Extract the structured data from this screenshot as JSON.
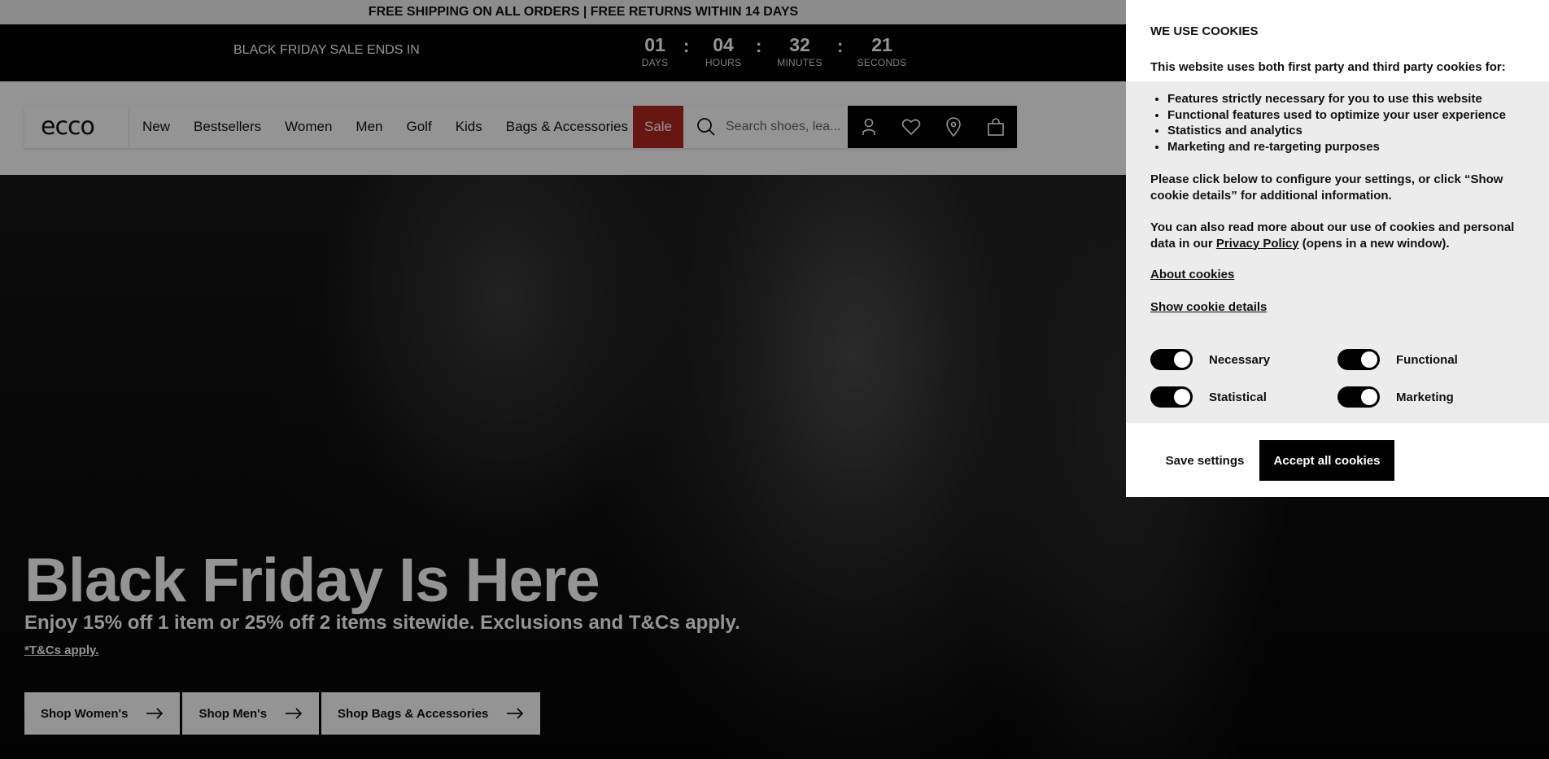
{
  "announcement": "FREE SHIPPING ON ALL ORDERS | FREE RETURNS WITHIN 14 DAYS",
  "countdown": {
    "label": "BLACK FRIDAY SALE ENDS IN",
    "days": "01",
    "days_label": "DAYS",
    "hours": "04",
    "hours_label": "HOURS",
    "minutes": "32",
    "minutes_label": "MINUTES",
    "seconds": "21",
    "seconds_label": "SECONDS",
    "separator": ":"
  },
  "nav": {
    "logo": "ecco",
    "links": [
      "New",
      "Bestsellers",
      "Women",
      "Men",
      "Golf",
      "Kids",
      "Bags & Accessories"
    ],
    "sale": "Sale",
    "search_placeholder": "Search shoes, lea..."
  },
  "hero": {
    "title": "Black Friday Is Here",
    "subtitle": "Enjoy 15% off 1 item or 25% off 2 items sitewide. Exclusions and T&Cs apply.",
    "tc_link": "*T&Cs apply.",
    "buttons": [
      "Shop Women's",
      "Shop Men's",
      "Shop Bags & Accessories"
    ]
  },
  "cookie": {
    "title": "WE USE COOKIES",
    "intro": "This website uses both first party and third party cookies for:",
    "purposes": [
      "Features strictly necessary for you to use this website",
      "Functional features used to optimize your user experience",
      "Statistics and analytics",
      "Marketing and re-targeting purposes"
    ],
    "configure_text": "Please click below to configure your settings, or click “Show cookie details” for additional information.",
    "read_more_before": "You can also read more about our use of cookies and personal data in our ",
    "privacy_link": "Privacy Policy",
    "read_more_after": " (opens in a new window).",
    "about_link": "About cookies",
    "details_link": "Show cookie details",
    "toggles": {
      "necessary": "Necessary",
      "functional": "Functional",
      "statistical": "Statistical",
      "marketing": "Marketing"
    },
    "save_button": "Save settings",
    "accept_button": "Accept all cookies"
  }
}
